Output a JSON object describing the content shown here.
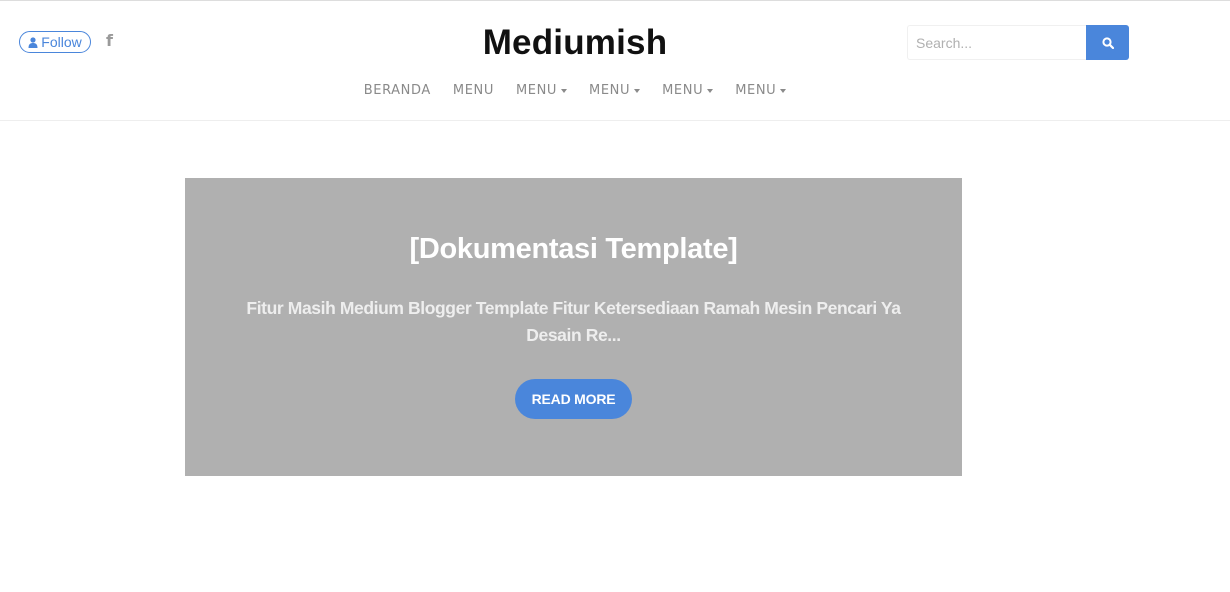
{
  "header": {
    "follow_label": "Follow",
    "social_icon": "facebook-icon",
    "site_title": "Mediumish",
    "search": {
      "placeholder": "Search...",
      "value": "",
      "button_icon": "search-icon"
    }
  },
  "nav": {
    "items": [
      {
        "label": "BERANDA",
        "dropdown": false
      },
      {
        "label": "MENU",
        "dropdown": false
      },
      {
        "label": "MENU",
        "dropdown": true
      },
      {
        "label": "MENU",
        "dropdown": true
      },
      {
        "label": "MENU",
        "dropdown": true
      },
      {
        "label": "MENU",
        "dropdown": true
      }
    ]
  },
  "featured_post": {
    "title": "[Dokumentasi Template]",
    "excerpt": "Fitur Masih Medium Blogger Template Fitur Ketersediaan Ramah Mesin Pencari Ya Desain Re...",
    "read_more_label": "READ MORE"
  },
  "colors": {
    "accent": "#4a86db",
    "hero_background": "#b0b0b0",
    "nav_text": "#8a8a8a"
  }
}
